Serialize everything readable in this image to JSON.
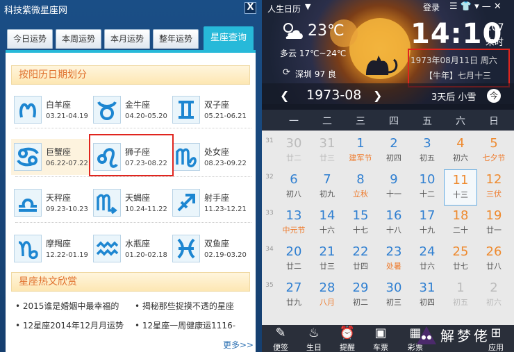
{
  "left": {
    "window_title": "科技紫微星座网",
    "close_label": "X",
    "tabs": [
      "今日运势",
      "本周运势",
      "本月运势",
      "整年运势",
      "星座查询"
    ],
    "section1_title": "按阳历日期划分",
    "signs": [
      {
        "name": "白羊座",
        "date": "03.21-04.19",
        "icon": "aries-icon"
      },
      {
        "name": "金牛座",
        "date": "04.20-05.20",
        "icon": "taurus-icon"
      },
      {
        "name": "双子座",
        "date": "05.21-06.21",
        "icon": "gemini-icon"
      },
      {
        "name": "巨蟹座",
        "date": "06.22-07.22",
        "icon": "cancer-icon"
      },
      {
        "name": "狮子座",
        "date": "07.23-08.22",
        "icon": "leo-icon"
      },
      {
        "name": "处女座",
        "date": "08.23-09.22",
        "icon": "virgo-icon"
      },
      {
        "name": "天秤座",
        "date": "09.23-10.23",
        "icon": "libra-icon"
      },
      {
        "name": "天蝎座",
        "date": "10.24-11.22",
        "icon": "scorpio-icon"
      },
      {
        "name": "射手座",
        "date": "11.23-12.21",
        "icon": "sagittarius-icon"
      },
      {
        "name": "摩羯座",
        "date": "12.22-01.19",
        "icon": "capricorn-icon"
      },
      {
        "name": "水瓶座",
        "date": "01.20-02.18",
        "icon": "aquarius-icon"
      },
      {
        "name": "双鱼座",
        "date": "02.19-03.20",
        "icon": "pisces-icon"
      }
    ],
    "section2_title": "星座热文欣赏",
    "news": [
      "• 2015谁是婚姻中最幸福的",
      "• 揭秘那些捉摸不透的星座",
      "• 12星座2014年12月月运势",
      "• 12星座一周健康运1116-"
    ],
    "more_label": "更多>>"
  },
  "right": {
    "app_name": "人生日历",
    "login": "登录",
    "weather": {
      "temp": "23℃",
      "desc": "多云 17℃~24℃",
      "city": "深圳 97 良"
    },
    "clock": {
      "time": "14:10",
      "seconds": ":07",
      "label": "未时"
    },
    "date_box": {
      "solar": "1973年08月11日 周六",
      "lunar": "【牛年】七月十三"
    },
    "forecast": "3天后 小雪",
    "today_btn": "今",
    "month_label": "1973-08",
    "prev": "❮",
    "next": "❯",
    "weekdays": [
      "一",
      "二",
      "三",
      "四",
      "五",
      "六",
      "日"
    ],
    "week_numbers": [
      "31",
      "32",
      "33",
      "34",
      "35"
    ],
    "weeks": [
      [
        {
          "n": "30",
          "l": "廿二",
          "dim": true
        },
        {
          "n": "31",
          "l": "廿三",
          "dim": true
        },
        {
          "n": "1",
          "l": "建军节",
          "f": true
        },
        {
          "n": "2",
          "l": "初四"
        },
        {
          "n": "3",
          "l": "初五"
        },
        {
          "n": "4",
          "l": "初六",
          "w": true
        },
        {
          "n": "5",
          "l": "七夕节",
          "w": true,
          "f": true
        }
      ],
      [
        {
          "n": "6",
          "l": "初八"
        },
        {
          "n": "7",
          "l": "初九"
        },
        {
          "n": "8",
          "l": "立秋",
          "f": true
        },
        {
          "n": "9",
          "l": "十一"
        },
        {
          "n": "10",
          "l": "十二"
        },
        {
          "n": "11",
          "l": "十三",
          "w": true,
          "t": true
        },
        {
          "n": "12",
          "l": "三伏",
          "w": true,
          "f": true
        }
      ],
      [
        {
          "n": "13",
          "l": "中元节",
          "f": true
        },
        {
          "n": "14",
          "l": "十六"
        },
        {
          "n": "15",
          "l": "十七"
        },
        {
          "n": "16",
          "l": "十八"
        },
        {
          "n": "17",
          "l": "十九"
        },
        {
          "n": "18",
          "l": "二十",
          "w": true
        },
        {
          "n": "19",
          "l": "廿一",
          "w": true
        }
      ],
      [
        {
          "n": "20",
          "l": "廿二"
        },
        {
          "n": "21",
          "l": "廿三"
        },
        {
          "n": "22",
          "l": "廿四"
        },
        {
          "n": "23",
          "l": "处暑",
          "f": true
        },
        {
          "n": "24",
          "l": "廿六"
        },
        {
          "n": "25",
          "l": "廿七",
          "w": true
        },
        {
          "n": "26",
          "l": "廿八",
          "w": true
        }
      ],
      [
        {
          "n": "27",
          "l": "廿九"
        },
        {
          "n": "28",
          "l": "八月",
          "f": true
        },
        {
          "n": "29",
          "l": "初二"
        },
        {
          "n": "30",
          "l": "初三"
        },
        {
          "n": "31",
          "l": "初四"
        },
        {
          "n": "1",
          "l": "初五",
          "w": true,
          "dim": true
        },
        {
          "n": "2",
          "l": "初六",
          "w": true,
          "dim": true
        }
      ]
    ],
    "bottom": [
      {
        "label": "便签",
        "icon": "pencil-icon"
      },
      {
        "label": "生日",
        "icon": "cake-icon"
      },
      {
        "label": "提醒",
        "icon": "alarm-icon"
      },
      {
        "label": "车票",
        "icon": "bus-icon"
      },
      {
        "label": "彩票",
        "icon": "lottery-icon"
      },
      {
        "label": "应用",
        "icon": "apps-icon"
      }
    ],
    "watermark": "解梦佬"
  }
}
